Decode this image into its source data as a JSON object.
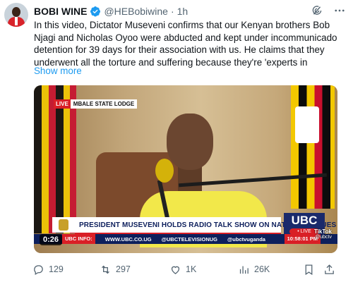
{
  "author": {
    "name": "BOBI WINE",
    "handle": "@HEBobiwine",
    "separator": "·",
    "time": "1h"
  },
  "tweet": {
    "text": "In this video, Dictator Museveni confirms that our Kenyan brothers Bob Njagi and Nicholas Oyoo were abducted and kept under incommunicado detention for 39 days for their association with us. He claims that they underwent all the torture and suffering because they're 'experts in",
    "show_more": "Show more"
  },
  "video": {
    "live_badge": "LIVE",
    "location": "MBALE STATE LODGE",
    "headline": "PRESIDENT MUSEVENI HOLDS RADIO TALK SHOW ON NATIONAL ISSUES",
    "channel": "UBC",
    "channel_live": "• LIVE",
    "info_label": "UBC INFO:",
    "info_site": "WWW.UBC.CO.UG",
    "info_x": "@UBCTELEVISIONUG",
    "info_ig": "@ubctvuganda",
    "clock": "10:58:01 PM",
    "duration": "0:26",
    "watermark": "TikTok",
    "watermark_handle": "@ubctv"
  },
  "actions": {
    "replies": "129",
    "reposts": "297",
    "likes": "1K",
    "views": "26K"
  },
  "icons": [
    "verified-badge-icon",
    "grok-icon",
    "more-icon",
    "reply-icon",
    "repost-icon",
    "like-icon",
    "views-icon",
    "bookmark-icon",
    "share-icon"
  ],
  "colors": {
    "accent": "#1d9bf0",
    "text": "#0f1419",
    "muted": "#536471",
    "ubc_red": "#d91f26",
    "ubc_navy": "#0d1f5c"
  }
}
